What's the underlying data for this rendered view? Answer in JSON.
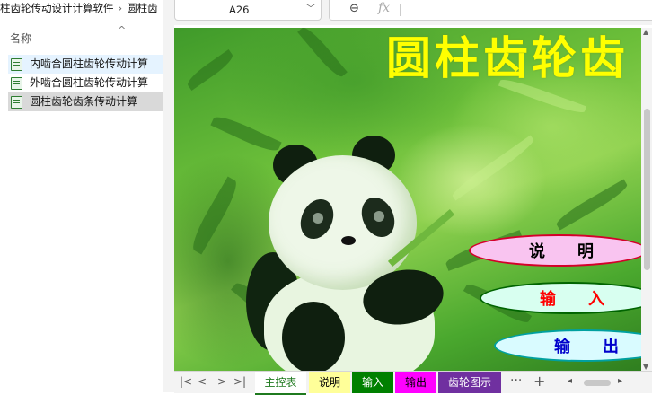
{
  "explorer": {
    "breadcrumb": [
      "柱齿轮传动设计计算软件",
      "圆柱齿"
    ],
    "column_header": "名称",
    "sort_indicator": "^",
    "files": [
      {
        "label": "内啮合圆柱齿轮传动计算",
        "state": "hover"
      },
      {
        "label": "外啮合圆柱齿轮传动计算",
        "state": "normal"
      },
      {
        "label": "圆柱齿轮齿条传动计算",
        "state": "selected"
      }
    ]
  },
  "formula_bar": {
    "cell_reference": "A26",
    "dropdown_icon": "chevron-down-icon",
    "zoom_icon": "magnifier-icon",
    "fx_label": "fx"
  },
  "sheet": {
    "title": "圆柱齿轮齿",
    "buttons": [
      {
        "label": "说　　明",
        "text_color": "#000000",
        "fill": "#f9c4f0",
        "border": "#d4002a"
      },
      {
        "label": "输　　入",
        "text_color": "#ff0000",
        "fill": "#d8fff0",
        "border": "#006400"
      },
      {
        "label": "输　　出",
        "text_color": "#0000cc",
        "fill": "#d9fbff",
        "border": "#00a0a0"
      }
    ]
  },
  "tabs": {
    "nav": {
      "first": "|<",
      "prev": "<",
      "next": ">",
      "last": ">|"
    },
    "items": [
      {
        "label": "主控表",
        "bg": "#ffffff",
        "color": "#1f7a1f",
        "active": true
      },
      {
        "label": "说明",
        "bg": "#ffff99",
        "color": "#000000",
        "active": false
      },
      {
        "label": "输入",
        "bg": "#008000",
        "color": "#ffffff",
        "active": false
      },
      {
        "label": "输出",
        "bg": "#ff00ff",
        "color": "#000000",
        "active": false
      },
      {
        "label": "齿轮图示",
        "bg": "#7030a0",
        "color": "#ffffff",
        "active": false
      }
    ],
    "more": "···",
    "add": "+",
    "scroll_left": "◂",
    "scroll_right": "▸"
  }
}
